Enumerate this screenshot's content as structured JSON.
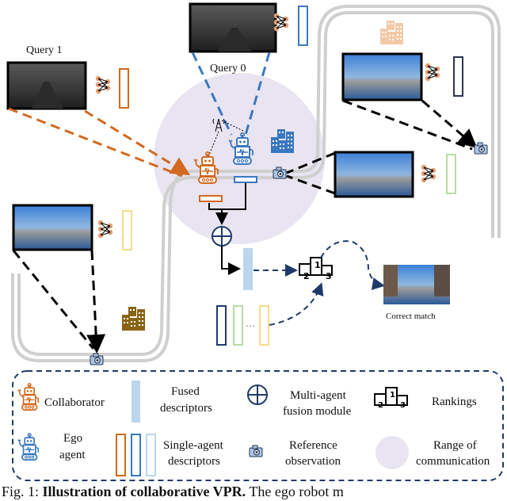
{
  "colors": {
    "collaborator": "#d2691e",
    "ego": "#3a78c0",
    "navy": "#1f3a6b",
    "road": "#cfcfcf",
    "range": "#e9e4f1",
    "fused": "#bcd6ee",
    "green_desc": "#b9dba2",
    "yellow_desc": "#f6dc8c",
    "dark_desc": "#2a3550",
    "building_peach": "#f4c9a8",
    "building_blue": "#3a78c0",
    "building_gold": "#8a6414",
    "camera": "#a9c6e6",
    "neuron": "#e8a072"
  },
  "labels": {
    "query0": "Query 0",
    "query1": "Query 1",
    "correct_match": "Correct match",
    "ellipsis": "…"
  },
  "ranking": {
    "first": "1",
    "second": "2",
    "third": "3"
  },
  "legend": {
    "collaborator": "Collaborator",
    "ego_line1": "Ego",
    "ego_line2": "agent",
    "fused_line1": "Fused",
    "fused_line2": "descriptors",
    "single_line1": "Single-agent",
    "single_line2": "descriptors",
    "fusion_line1": "Multi-agent",
    "fusion_line2": "fusion module",
    "reference_line1": "Reference",
    "reference_line2": "observation",
    "rankings": "Rankings",
    "range_line1": "Range of",
    "range_line2": "communication"
  },
  "caption": {
    "prefix": "Fig. 1: ",
    "bold": "Illustration of collaborative VPR.",
    "rest": " The ego robot m"
  }
}
